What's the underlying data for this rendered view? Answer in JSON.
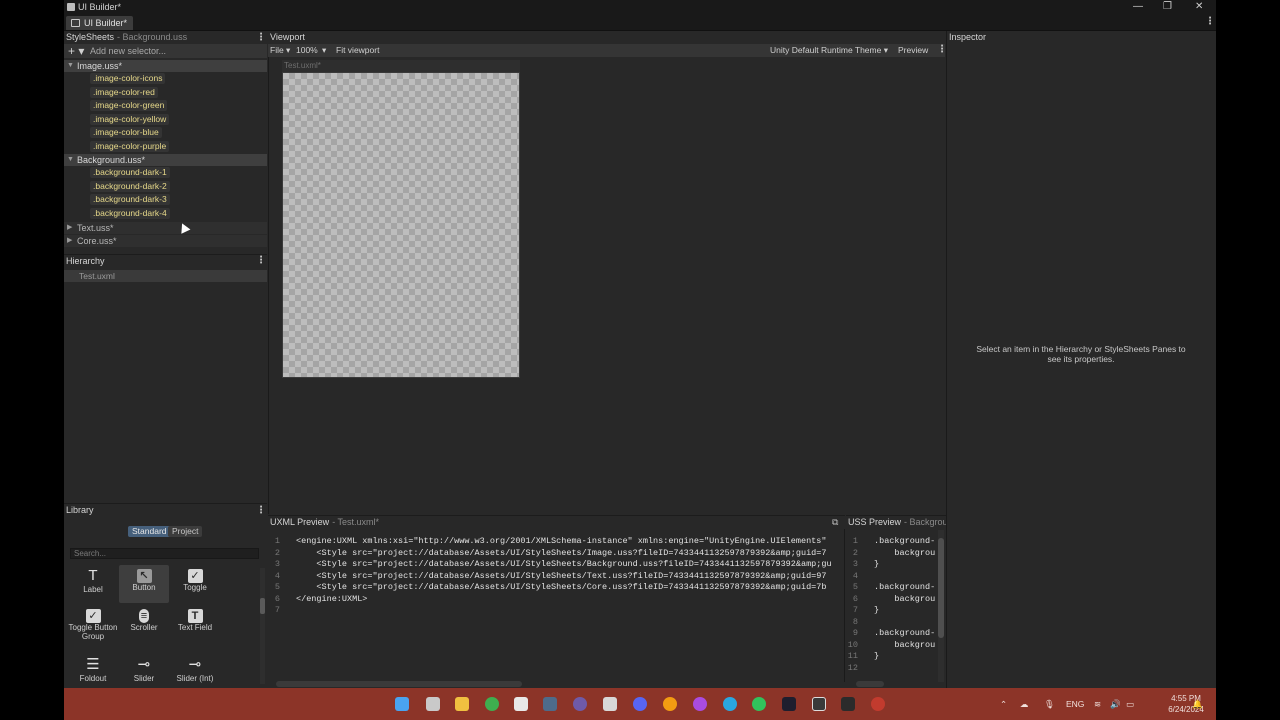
{
  "window": {
    "title": "UI Builder*",
    "tab": "UI Builder*",
    "min": "—",
    "restore": "❐",
    "close": "✕"
  },
  "stylesheets": {
    "header": "StyleSheets",
    "subtitle": "- Background.uss",
    "add_selector_placeholder": "Add new selector...",
    "groups": [
      {
        "name": "Image.uss*",
        "expanded": true,
        "selectors": [
          ".image-color-icons",
          ".image-color-red",
          ".image-color-green",
          ".image-color-yellow",
          ".image-color-blue",
          ".image-color-purple"
        ]
      },
      {
        "name": "Background.uss*",
        "expanded": true,
        "selectors": [
          ".background-dark-1",
          ".background-dark-2",
          ".background-dark-3",
          ".background-dark-4"
        ]
      },
      {
        "name": "Text.uss*",
        "expanded": false,
        "selectors": []
      },
      {
        "name": "Core.uss*",
        "expanded": false,
        "selectors": []
      }
    ]
  },
  "hierarchy": {
    "header": "Hierarchy",
    "items": [
      "Test.uxml"
    ]
  },
  "library": {
    "header": "Library",
    "tabs": [
      "Standard",
      "Project"
    ],
    "search_placeholder": "Search...",
    "items": [
      {
        "label": "Label",
        "icon": "label-icon"
      },
      {
        "label": "Button",
        "icon": "button-icon"
      },
      {
        "label": "Toggle",
        "icon": "toggle-icon"
      },
      {
        "label": "Toggle Button Group",
        "icon": "toggle-button-group-icon"
      },
      {
        "label": "Scroller",
        "icon": "scroller-icon"
      },
      {
        "label": "Text Field",
        "icon": "text-field-icon"
      },
      {
        "label": "Foldout",
        "icon": "foldout-icon"
      },
      {
        "label": "Slider",
        "icon": "slider-icon"
      },
      {
        "label": "Slider (Int)",
        "icon": "slider-int-icon"
      }
    ]
  },
  "viewport": {
    "header": "Viewport",
    "file_menu": "File ▾",
    "zoom": "100%",
    "fit": "Fit viewport",
    "theme": "Unity Default Runtime Theme ▾",
    "preview": "Preview",
    "canvas_title": "Test.uxml*"
  },
  "inspector": {
    "header": "Inspector",
    "message": "Select an item in the Hierarchy or StyleSheets Panes to see its properties."
  },
  "uxml_preview": {
    "header": "UXML Preview",
    "subtitle": "- Test.uxml*",
    "lines": [
      "<engine:UXML xmlns:xsi=\"http://www.w3.org/2001/XMLSchema-instance\" xmlns:engine=\"UnityEngine.UIElements\"",
      "    <Style src=\"project://database/Assets/UI/StyleSheets/Image.uss?fileID=7433441132597879392&amp;guid=7",
      "    <Style src=\"project://database/Assets/UI/StyleSheets/Background.uss?fileID=7433441132597879392&amp;gu",
      "    <Style src=\"project://database/Assets/UI/StyleSheets/Text.uss?fileID=7433441132597879392&amp;guid=97",
      "    <Style src=\"project://database/Assets/UI/StyleSheets/Core.uss?fileID=7433441132597879392&amp;guid=7b",
      "</engine:UXML>",
      ""
    ]
  },
  "uss_preview": {
    "header": "USS Preview",
    "subtitle": "- Backgroun",
    "lines": [
      ".background-",
      "    backgrou",
      "}",
      "",
      ".background-",
      "    backgrou",
      "}",
      "",
      ".background-",
      "    backgrou",
      "}",
      "",
      ""
    ]
  },
  "taskbar": {
    "lang": "ENG",
    "time": "4:55 PM",
    "date": "6/24/2024"
  }
}
